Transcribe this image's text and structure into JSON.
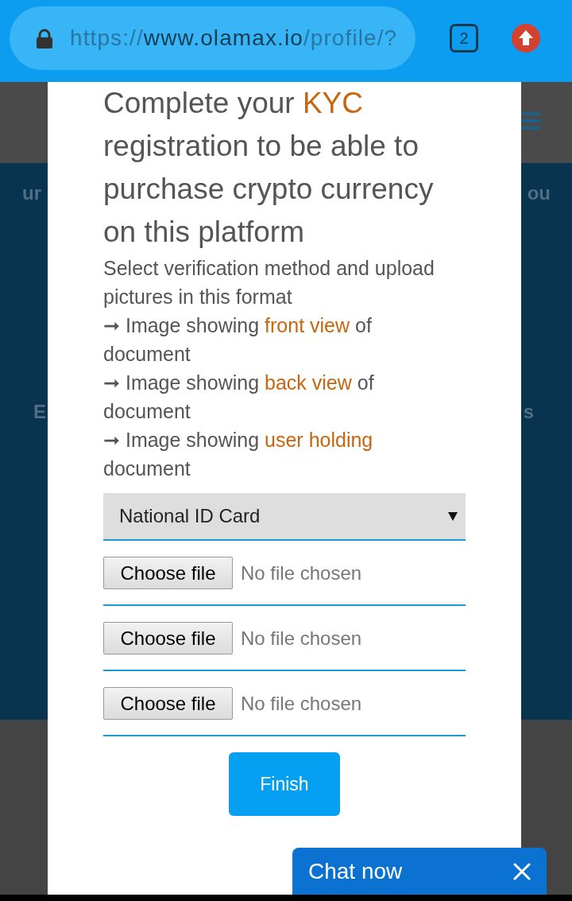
{
  "browser": {
    "url": {
      "scheme": "https://",
      "host": "www.olamax.io",
      "path": "/profile/?"
    },
    "tab_count": "2"
  },
  "background": {
    "rows": [
      {
        "left": "ur",
        "right": "ou"
      },
      {
        "left": "E",
        "right": "s"
      }
    ]
  },
  "modal": {
    "title": [
      {
        "text": "Complete your ",
        "highlight": false
      },
      {
        "text": "KYC",
        "highlight": true
      },
      {
        "text": " registration to be able to purchase crypto currency on this platform",
        "highlight": false
      }
    ],
    "intro": "Select verification method and upload pictures in this format",
    "requirements": [
      {
        "parts": [
          {
            "text": "➞ Image showing ",
            "highlight": false
          },
          {
            "text": "front view",
            "highlight": true
          },
          {
            "text": " of document",
            "highlight": false
          }
        ]
      },
      {
        "parts": [
          {
            "text": "➞ Image showing ",
            "highlight": false
          },
          {
            "text": "back view",
            "highlight": true
          },
          {
            "text": " of document",
            "highlight": false
          }
        ]
      },
      {
        "parts": [
          {
            "text": "➞ Image showing ",
            "highlight": false
          },
          {
            "text": "user holding",
            "highlight": true
          },
          {
            "text": " document",
            "highlight": false
          }
        ]
      }
    ],
    "method_select": {
      "value": "National ID Card"
    },
    "uploads": [
      {
        "button": "Choose file",
        "status": "No file chosen"
      },
      {
        "button": "Choose file",
        "status": "No file chosen"
      },
      {
        "button": "Choose file",
        "status": "No file chosen"
      }
    ],
    "finish_button": "Finish"
  },
  "chat_widget": {
    "label": "Chat now"
  }
}
